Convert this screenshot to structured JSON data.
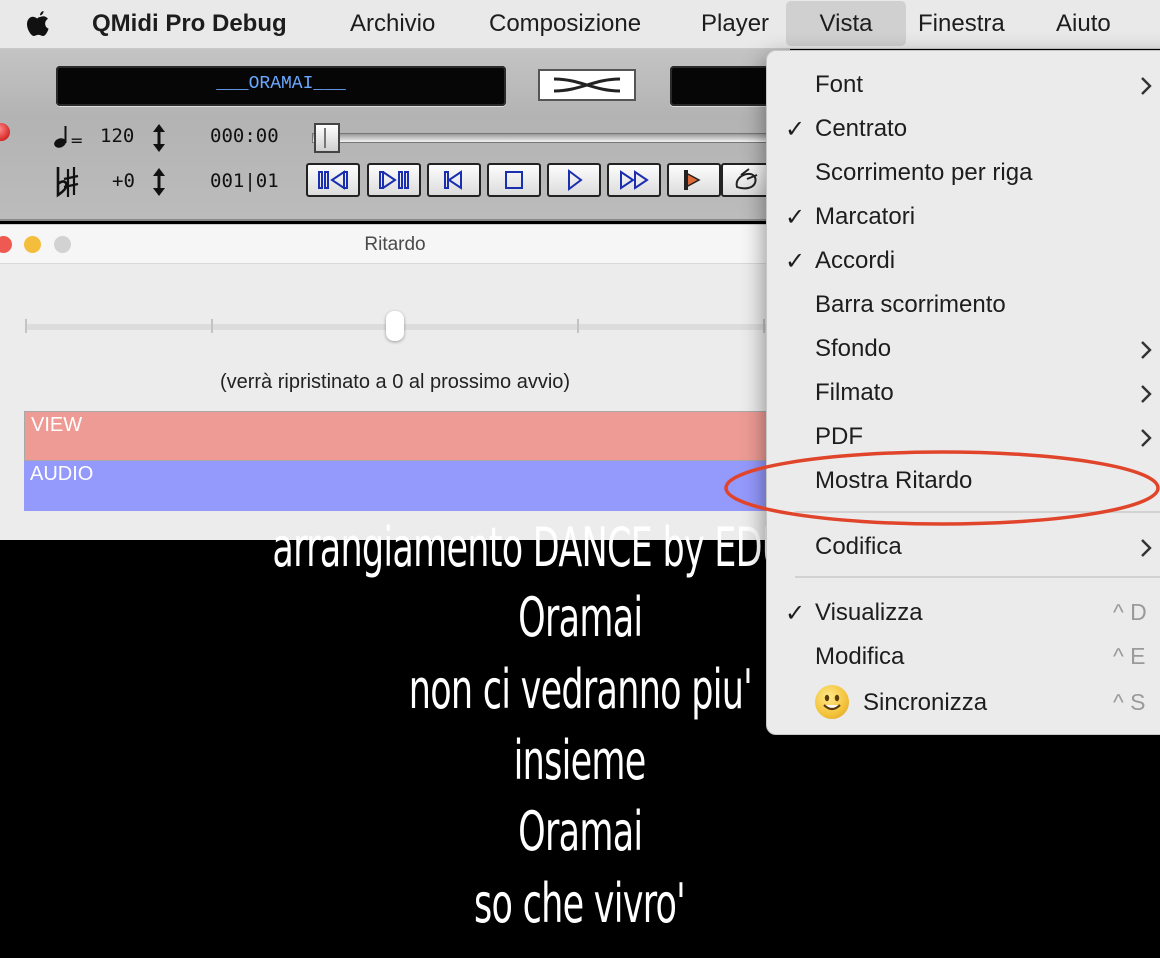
{
  "menubar": {
    "app_name": "QMidi Pro Debug",
    "items": [
      "Archivio",
      "Composizione",
      "Player",
      "Vista",
      "Finestra",
      "Aiuto"
    ],
    "active": "Vista"
  },
  "player": {
    "song_title": "___ORAMAI___",
    "tempo": "120",
    "time": "000:00",
    "transpose": "+0",
    "position": "001|01"
  },
  "ritardo_window": {
    "title": "Ritardo",
    "note": "(verrà ripristinato a 0 al prossimo avvio)",
    "view_label": "VIEW",
    "audio_label": "AUDIO",
    "view_color": "#ef9b95",
    "audio_color": "#9499fc"
  },
  "lyrics": [
    "arrangiamento DANCE by EDUARDO",
    "Oramai",
    "non ci vedranno piu'",
    "insieme",
    "Oramai",
    "so che vivro'"
  ],
  "view_menu": {
    "items": [
      {
        "label": "Font",
        "checked": false,
        "submenu": true
      },
      {
        "label": "Centrato",
        "checked": true,
        "submenu": false
      },
      {
        "label": "Scorrimento per riga",
        "checked": false,
        "submenu": false
      },
      {
        "label": "Marcatori",
        "checked": true,
        "submenu": false
      },
      {
        "label": "Accordi",
        "checked": true,
        "submenu": false
      },
      {
        "label": "Barra scorrimento",
        "checked": false,
        "submenu": false
      },
      {
        "label": "Sfondo",
        "checked": false,
        "submenu": true
      },
      {
        "label": "Filmato",
        "checked": false,
        "submenu": true
      },
      {
        "label": "PDF",
        "checked": false,
        "submenu": true
      },
      {
        "label": "Mostra Ritardo",
        "checked": false,
        "submenu": false
      }
    ],
    "codifica": {
      "label": "Codifica",
      "submenu": true
    },
    "mode_items": [
      {
        "label": "Visualizza",
        "checked": true,
        "shortcut": "^ D"
      },
      {
        "label": "Modifica",
        "checked": false,
        "shortcut": "^ E"
      },
      {
        "label": "Sincronizza",
        "checked": false,
        "shortcut": "^ S"
      }
    ],
    "check_glyph": "✓",
    "highlight_color": "#e0452b"
  }
}
